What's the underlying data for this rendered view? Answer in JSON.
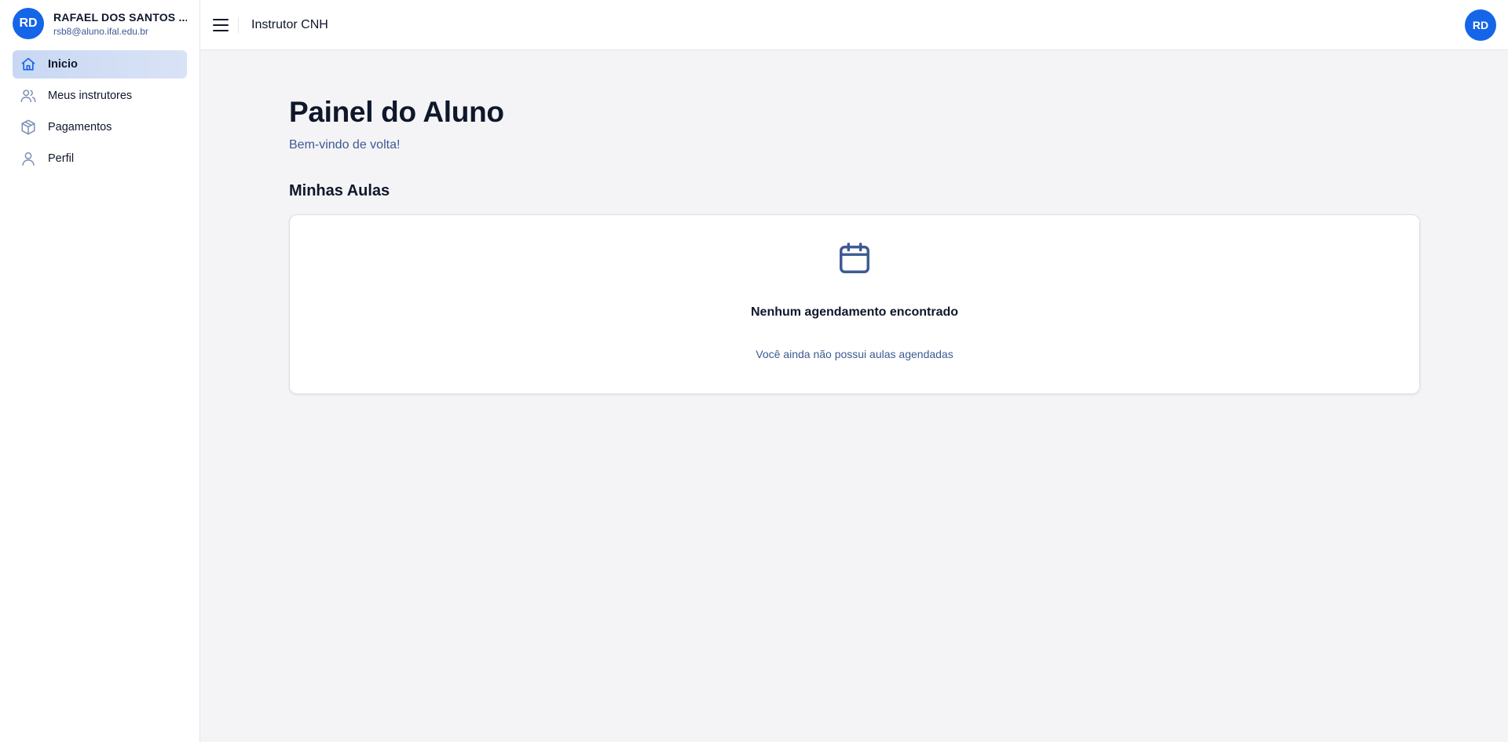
{
  "sidebar": {
    "user": {
      "initials": "RD",
      "name": "RAFAEL DOS SANTOS ...",
      "email": "rsb8@aluno.ifal.edu.br"
    },
    "items": [
      {
        "label": "Inicio",
        "icon": "home-icon",
        "active": true
      },
      {
        "label": "Meus instrutores",
        "icon": "users-icon",
        "active": false
      },
      {
        "label": "Pagamentos",
        "icon": "package-icon",
        "active": false
      },
      {
        "label": "Perfil",
        "icon": "user-icon",
        "active": false
      }
    ]
  },
  "header": {
    "app_title": "Instrutor CNH",
    "avatar_initials": "RD"
  },
  "main": {
    "title": "Painel do Aluno",
    "subtitle": "Bem-vindo de volta!",
    "section_title": "Minhas Aulas",
    "empty_state": {
      "icon": "calendar-icon",
      "title": "Nenhum agendamento encontrado",
      "message": "Você ainda não possui aulas agendadas"
    }
  },
  "colors": {
    "accent": "#1565e8",
    "active_nav": "#c8d8f3",
    "muted_text": "#3d5a93",
    "background": "#f4f4f6"
  }
}
